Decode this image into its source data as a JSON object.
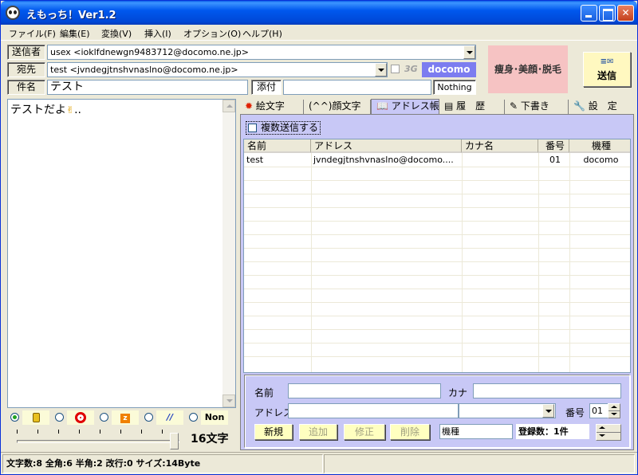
{
  "window": {
    "title": "えもっち！Ver1.2"
  },
  "menu": [
    "ファイル(F)",
    "編集(E)",
    "変換(V)",
    "挿入(I)",
    "オプション(O)",
    "ヘルプ(H)"
  ],
  "header": {
    "from_label": "送信者",
    "from_value": "usex <ioklfdnewgn9483712@docomo.ne.jp>",
    "to_label": "宛先",
    "to_value": "test <jvndegjtnshvnaslno@docomo.ne.jp>",
    "threeg_label": "3G",
    "carrier_badge": "docomo",
    "subject_label": "件名",
    "subject_value": "テスト",
    "attach_label": "添付",
    "attach_value": "Nothing",
    "ad_text": "痩身･美顔･脱毛",
    "send_label": "送信"
  },
  "editor": {
    "body": "テストだよ",
    "emoji": "✌",
    "trail": ".."
  },
  "carriers": [
    {
      "label": "",
      "selected": true
    },
    {
      "label": "",
      "selected": false
    },
    {
      "label": "",
      "selected": false
    },
    {
      "label": "",
      "selected": false
    },
    {
      "label": "Non",
      "selected": false
    }
  ],
  "char_count": "16文字",
  "tabs": [
    "絵文字",
    "(^^)顔文字",
    "アドレス帳",
    "履　歴",
    "下書き",
    "設　定"
  ],
  "addressbook": {
    "multi_send_label": "複数送信する",
    "columns": [
      "名前",
      "アドレス",
      "カナ名",
      "番号",
      "機種"
    ],
    "rows": [
      {
        "name": "test",
        "address": "jvndegjtnshvnaslno@docomo....",
        "kana": "",
        "number": "01",
        "model": "docomo"
      }
    ],
    "form": {
      "name_label": "名前",
      "kana_label": "カナ",
      "address_label": "アドレス",
      "number_label": "番号",
      "number_value": "01",
      "model_label": "機種",
      "count_text": "登録数：1件",
      "btn_new": "新規",
      "btn_add": "追加",
      "btn_edit": "修正",
      "btn_delete": "削除"
    }
  },
  "status": {
    "text": "文字数:8 全角:6 半角:2 改行:0 サイズ:14Byte"
  }
}
